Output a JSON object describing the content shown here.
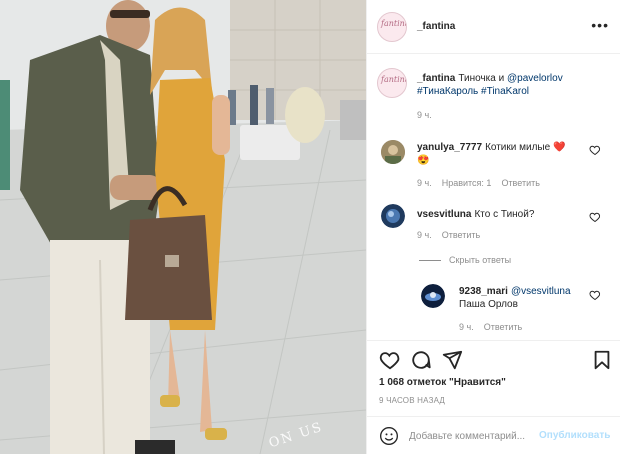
{
  "post": {
    "author": "_fantina",
    "more_icon": "more-horizontal-icon"
  },
  "caption": {
    "author": "_fantina",
    "text": "Тиночка и",
    "mention": "@pavelorlov",
    "hashtags": "#ТинаКароль #TinaKarol",
    "time": "9 ч."
  },
  "comments": [
    {
      "user": "yanulya_7777",
      "text": "Котики милые",
      "emoji_1": "❤️",
      "emoji_2": "😍",
      "time": "9 ч.",
      "likes": "Нравится: 1",
      "reply": "Ответить"
    },
    {
      "user": "vsesvitluna",
      "text": "Кто с Тиной?",
      "time": "9 ч.",
      "reply": "Ответить"
    }
  ],
  "hide_replies": "Скрыть ответы",
  "reply": {
    "user": "9238_mari",
    "mention": "@vsesvitluna",
    "text": "Паша Орлов",
    "time": "9 ч.",
    "reply_label": "Ответить"
  },
  "actions": {
    "like_icon": "heart-icon",
    "comment_icon": "comment-icon",
    "share_icon": "share-icon",
    "save_icon": "bookmark-icon"
  },
  "likes_text": "1 068 отметок \"Нравится\"",
  "posted_ago": "9 ЧАСОВ НАЗАД",
  "add_comment": {
    "placeholder": "Добавьте комментарий...",
    "publish_label": "Опубликовать",
    "emoji_icon": "smiley-icon"
  },
  "photo": {
    "watermark": "ON US"
  },
  "colors": {
    "link": "#00376b",
    "muted": "#8e8e8e",
    "publish_disabled": "#b2dffc",
    "heart_red": "#ed4956"
  }
}
